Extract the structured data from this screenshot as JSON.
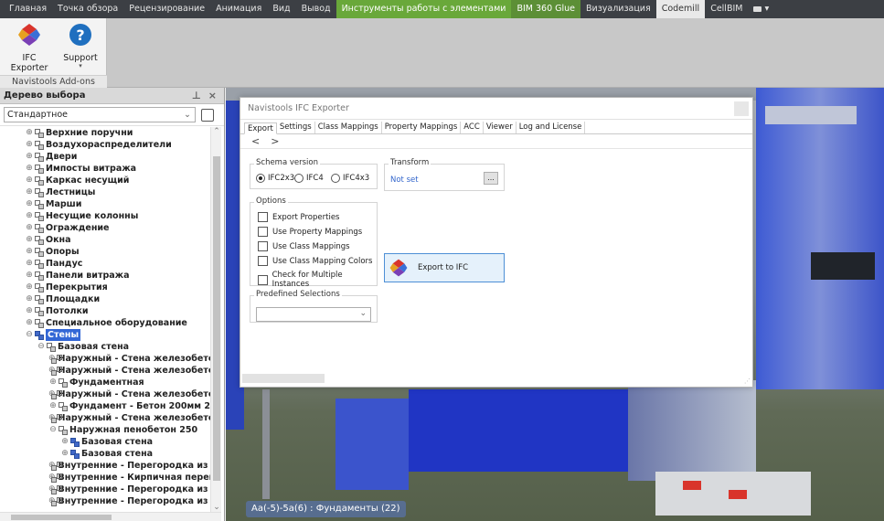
{
  "menu": {
    "items": [
      {
        "label": "Главная",
        "style": ""
      },
      {
        "label": "Точка обзора",
        "style": ""
      },
      {
        "label": "Рецензирование",
        "style": ""
      },
      {
        "label": "Анимация",
        "style": ""
      },
      {
        "label": "Вид",
        "style": ""
      },
      {
        "label": "Вывод",
        "style": ""
      },
      {
        "label": "Инструменты работы с элементами",
        "style": "hl"
      },
      {
        "label": "BIM 360 Glue",
        "style": "hl2"
      },
      {
        "label": "Визуализация",
        "style": ""
      },
      {
        "label": "Codemill",
        "style": "active"
      },
      {
        "label": "CellBIM",
        "style": ""
      }
    ]
  },
  "ribbon": {
    "ifc_exporter_label": "IFC Exporter",
    "support_label": "Support",
    "panel_caption": "Navistools Add-ons"
  },
  "tree": {
    "title": "Дерево выбора",
    "pin_glyph": "⊥",
    "close_glyph": "×",
    "mode_value": "Стандартное",
    "rows": [
      {
        "indent": 1,
        "exp": "⊕",
        "label": "Верхние поручни",
        "icon": "grey",
        "sel": false
      },
      {
        "indent": 1,
        "exp": "⊕",
        "label": "Воздухораспределители",
        "icon": "grey",
        "sel": false
      },
      {
        "indent": 1,
        "exp": "⊕",
        "label": "Двери",
        "icon": "grey",
        "sel": false
      },
      {
        "indent": 1,
        "exp": "⊕",
        "label": "Импосты витража",
        "icon": "grey",
        "sel": false
      },
      {
        "indent": 1,
        "exp": "⊕",
        "label": "Каркас несущий",
        "icon": "grey",
        "sel": false
      },
      {
        "indent": 1,
        "exp": "⊕",
        "label": "Лестницы",
        "icon": "grey",
        "sel": false
      },
      {
        "indent": 1,
        "exp": "⊕",
        "label": "Марши",
        "icon": "grey",
        "sel": false
      },
      {
        "indent": 1,
        "exp": "⊕",
        "label": "Несущие колонны",
        "icon": "grey",
        "sel": false
      },
      {
        "indent": 1,
        "exp": "⊕",
        "label": "Ограждение",
        "icon": "grey",
        "sel": false
      },
      {
        "indent": 1,
        "exp": "⊕",
        "label": "Окна",
        "icon": "grey",
        "sel": false
      },
      {
        "indent": 1,
        "exp": "⊕",
        "label": "Опоры",
        "icon": "grey",
        "sel": false
      },
      {
        "indent": 1,
        "exp": "⊕",
        "label": "Пандус",
        "icon": "grey",
        "sel": false
      },
      {
        "indent": 1,
        "exp": "⊕",
        "label": "Панели витража",
        "icon": "grey",
        "sel": false
      },
      {
        "indent": 1,
        "exp": "⊕",
        "label": "Перекрытия",
        "icon": "grey",
        "sel": false
      },
      {
        "indent": 1,
        "exp": "⊕",
        "label": "Площадки",
        "icon": "grey",
        "sel": false
      },
      {
        "indent": 1,
        "exp": "⊕",
        "label": "Потолки",
        "icon": "grey",
        "sel": false
      },
      {
        "indent": 1,
        "exp": "⊕",
        "label": "Специальное оборудование",
        "icon": "grey",
        "sel": false
      },
      {
        "indent": 1,
        "exp": "⊖",
        "label": "Стены",
        "icon": "blue",
        "sel": true
      },
      {
        "indent": 2,
        "exp": "⊖",
        "label": "Базовая стена",
        "icon": "grey",
        "sel": false
      },
      {
        "indent": 3,
        "exp": "⊕",
        "label": "Наружный - Стена железобетонн",
        "icon": "grey",
        "sel": false
      },
      {
        "indent": 3,
        "exp": "⊕",
        "label": "Наружный - Стена железобетонн",
        "icon": "grey",
        "sel": false
      },
      {
        "indent": 3,
        "exp": "⊕",
        "label": "Фундаментная",
        "icon": "grey",
        "sel": false
      },
      {
        "indent": 3,
        "exp": "⊕",
        "label": "Наружный - Стена железобетонн",
        "icon": "grey",
        "sel": false
      },
      {
        "indent": 3,
        "exp": "⊕",
        "label": "Фундамент - Бетон 200мм 2",
        "icon": "grey",
        "sel": false
      },
      {
        "indent": 3,
        "exp": "⊕",
        "label": "Наружный - Стена железобетонн",
        "icon": "grey",
        "sel": false
      },
      {
        "indent": 3,
        "exp": "⊖",
        "label": "Наружная пенобетон 250",
        "icon": "grey",
        "sel": false
      },
      {
        "indent": 4,
        "exp": "⊕",
        "label": "Базовая стена",
        "icon": "blue",
        "sel": false
      },
      {
        "indent": 4,
        "exp": "⊕",
        "label": "Базовая стена",
        "icon": "blue",
        "sel": false
      },
      {
        "indent": 3,
        "exp": "⊕",
        "label": "Внутренние - Перегородка из пе",
        "icon": "grey",
        "sel": false
      },
      {
        "indent": 3,
        "exp": "⊕",
        "label": "Внутренние - Кирпичная перего",
        "icon": "grey",
        "sel": false
      },
      {
        "indent": 3,
        "exp": "⊕",
        "label": "Внутренние - Перегородка из пе",
        "icon": "grey",
        "sel": false
      },
      {
        "indent": 3,
        "exp": "⊕",
        "label": "Внутренние - Перегородка из пе",
        "icon": "grey",
        "sel": false
      }
    ]
  },
  "viewport": {
    "status_text": "Аа(-5)-5а(6) : Фундаменты (22)"
  },
  "dialog": {
    "title": "Navistools IFC Exporter",
    "tabs": [
      "Export",
      "Settings",
      "Class Mappings",
      "Property Mappings",
      "ACC",
      "Viewer",
      "Log and License"
    ],
    "active_tab": 0,
    "nav_back": "<",
    "nav_fwd": ">",
    "schema": {
      "title": "Schema version",
      "options": [
        "IFC2x3",
        "IFC4",
        "IFC4x3"
      ],
      "selected": 0
    },
    "transform": {
      "title": "Transform",
      "value": "Not set",
      "browse_label": "..."
    },
    "options": {
      "title": "Options",
      "items": [
        "Export Properties",
        "Use Property Mappings",
        "Use Class Mappings",
        "Use Class Mapping Colors",
        "Check for Multiple Instances"
      ]
    },
    "export_button": "Export to IFC",
    "predefined": {
      "title": "Predefined Selections",
      "value": ""
    }
  },
  "colors": {
    "menubar": "#3c3f44",
    "menu_highlight": "#69a83a",
    "tree_selection": "#3367d6",
    "model_blue": "#1f3fd0",
    "export_button_border": "#4d8fd6"
  }
}
